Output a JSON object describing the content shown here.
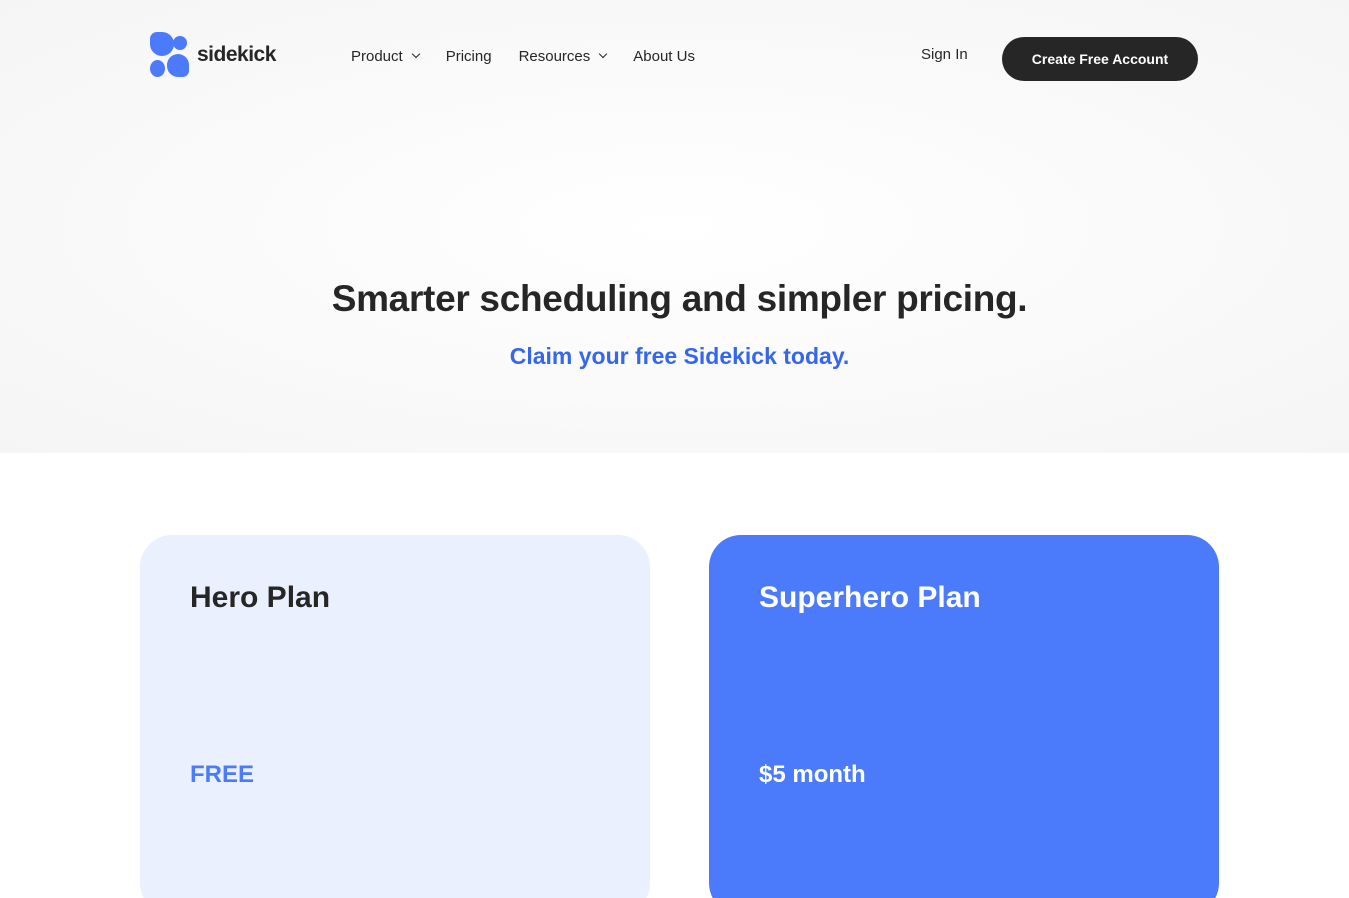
{
  "header": {
    "logo_text": "sidekick",
    "nav": [
      {
        "label": "Product",
        "has_dropdown": true
      },
      {
        "label": "Pricing",
        "has_dropdown": false
      },
      {
        "label": "Resources",
        "has_dropdown": true
      },
      {
        "label": "About Us",
        "has_dropdown": false
      }
    ],
    "sign_in_label": "Sign In",
    "cta_label": "Create Free Account"
  },
  "hero": {
    "title": "Smarter scheduling and simpler pricing.",
    "subtitle": "Claim your free Sidekick today."
  },
  "plans": [
    {
      "name": "Hero Plan",
      "price": "FREE"
    },
    {
      "name": "Superhero Plan",
      "price": "$5 month"
    }
  ],
  "colors": {
    "brand_blue": "#4b7bfb",
    "subtitle_blue": "#3466ee",
    "dark": "#262626",
    "light_card": "#ebf0fe"
  },
  "icons": [
    "logo-mark-icon",
    "chevron-down-icon"
  ]
}
